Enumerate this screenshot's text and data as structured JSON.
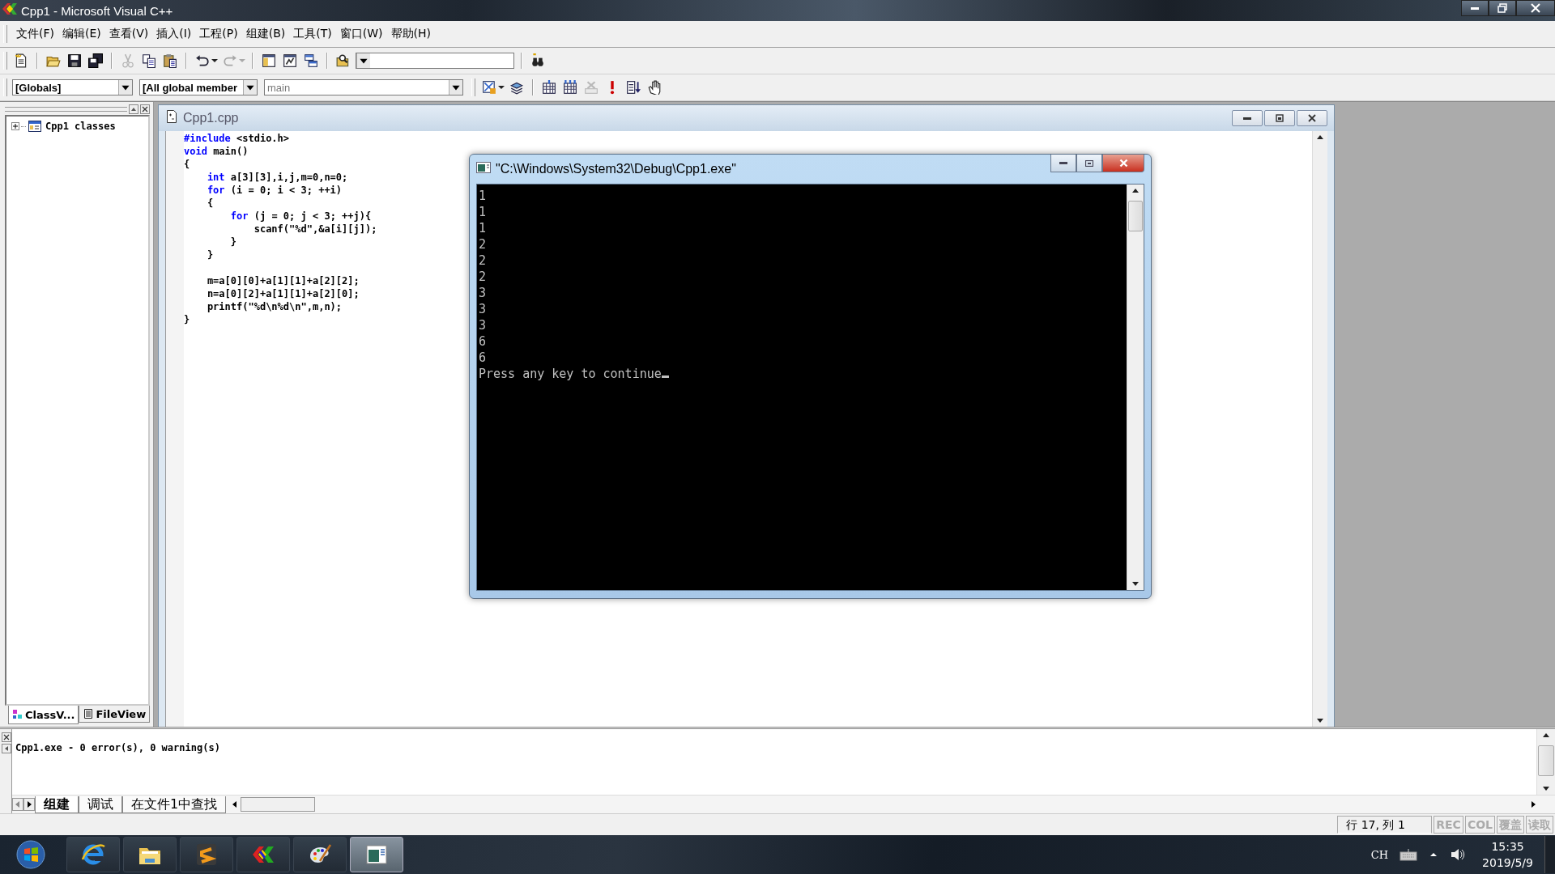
{
  "window": {
    "title": "Cpp1 - Microsoft Visual C++"
  },
  "menu": [
    {
      "label": "文件(F)"
    },
    {
      "label": "编辑(E)"
    },
    {
      "label": "查看(V)"
    },
    {
      "label": "插入(I)"
    },
    {
      "label": "工程(P)"
    },
    {
      "label": "组建(B)"
    },
    {
      "label": "工具(T)"
    },
    {
      "label": "窗口(W)"
    },
    {
      "label": "帮助(H)"
    }
  ],
  "toolbar": [
    {
      "kind": "new",
      "disabled": false
    },
    {
      "kind": "sep"
    },
    {
      "kind": "open",
      "disabled": false
    },
    {
      "kind": "save",
      "disabled": false
    },
    {
      "kind": "saveall",
      "disabled": false
    },
    {
      "kind": "sep"
    },
    {
      "kind": "cut",
      "disabled": true
    },
    {
      "kind": "copy",
      "disabled": false
    },
    {
      "kind": "paste",
      "disabled": false
    },
    {
      "kind": "sep"
    },
    {
      "kind": "undo",
      "disabled": false
    },
    {
      "kind": "redo",
      "disabled": true
    },
    {
      "kind": "sep"
    },
    {
      "kind": "workspace",
      "disabled": false
    },
    {
      "kind": "output",
      "disabled": false
    },
    {
      "kind": "windows",
      "disabled": false
    },
    {
      "kind": "sep"
    },
    {
      "kind": "findfiles",
      "disabled": false
    },
    {
      "kind": "findcombo"
    },
    {
      "kind": "sep"
    },
    {
      "kind": "find",
      "disabled": false
    }
  ],
  "wizard_bar": {
    "combos": [
      "[Globals]",
      "[All global member",
      "main"
    ]
  },
  "build_toolbar": [
    {
      "kind": "wizard",
      "disabled": false
    },
    {
      "kind": "sep"
    },
    {
      "kind": "compile",
      "disabled": false
    },
    {
      "kind": "build",
      "disabled": false
    },
    {
      "kind": "stop",
      "disabled": true
    },
    {
      "kind": "execute",
      "disabled": false
    },
    {
      "kind": "go",
      "disabled": false
    },
    {
      "kind": "breakpoint",
      "disabled": false
    }
  ],
  "workspace": {
    "tree": [
      {
        "label": "Cpp1 classes",
        "expanded": false
      }
    ],
    "tabs": [
      {
        "label": "ClassV...",
        "selected": true
      },
      {
        "label": "FileView",
        "selected": false
      }
    ]
  },
  "editor": {
    "title": "Cpp1.cpp",
    "lines": [
      {
        "segments": [
          {
            "kind": "keyword",
            "text": "#include"
          },
          {
            "kind": "plain",
            "text": " <stdio.h>"
          }
        ]
      },
      {
        "segments": [
          {
            "kind": "keyword",
            "text": "void"
          },
          {
            "kind": "plain",
            "text": " main()"
          }
        ]
      },
      {
        "segments": [
          {
            "kind": "plain",
            "text": "{"
          }
        ]
      },
      {
        "segments": [
          {
            "kind": "keyword",
            "text": "    int"
          },
          {
            "kind": "plain",
            "text": " a[3][3],i,j,m=0,n=0;"
          }
        ]
      },
      {
        "segments": [
          {
            "kind": "keyword",
            "text": "    for"
          },
          {
            "kind": "plain",
            "text": " (i = 0; i < 3; ++i)"
          }
        ]
      },
      {
        "segments": [
          {
            "kind": "plain",
            "text": "    {"
          }
        ]
      },
      {
        "segments": [
          {
            "kind": "keyword",
            "text": "        for"
          },
          {
            "kind": "plain",
            "text": " (j = 0; j < 3; ++j){"
          }
        ]
      },
      {
        "segments": [
          {
            "kind": "plain",
            "text": "            scanf(\"%d\",&a[i][j]);"
          }
        ]
      },
      {
        "segments": [
          {
            "kind": "plain",
            "text": "        }"
          }
        ]
      },
      {
        "segments": [
          {
            "kind": "plain",
            "text": "    }"
          }
        ]
      },
      {
        "kind": "blank"
      },
      {
        "segments": [
          {
            "kind": "plain",
            "text": "    m=a[0][0]+a[1][1]+a[2][2];"
          }
        ]
      },
      {
        "segments": [
          {
            "kind": "plain",
            "text": "    n=a[0][2]+a[1][1]+a[2][0];"
          }
        ]
      },
      {
        "segments": [
          {
            "kind": "plain",
            "text": "    printf(\"%d\\n%d\\n\",m,n);"
          }
        ]
      },
      {
        "segments": [
          {
            "kind": "plain",
            "text": "}"
          }
        ]
      }
    ]
  },
  "console": {
    "title": "\"C:\\Windows\\System32\\Debug\\Cpp1.exe\"",
    "lines": [
      "1",
      "1",
      "1",
      "2",
      "2",
      "2",
      "3",
      "3",
      "3",
      "6",
      "6",
      "Press any key to continue"
    ],
    "cursor": true
  },
  "output": {
    "lines": [
      "Cpp1.exe - 0 error(s), 0 warning(s)"
    ],
    "tabs": [
      {
        "label": "组建",
        "selected": true
      },
      {
        "label": "调试",
        "selected": false
      },
      {
        "label": "在文件1中查找",
        "selected": false
      }
    ]
  },
  "status_bar": {
    "position": "行 17, 列 1",
    "indicators": [
      {
        "label": "REC",
        "active": false
      },
      {
        "label": "COL",
        "active": false
      },
      {
        "label": "覆盖",
        "active": false
      },
      {
        "label": "读取",
        "active": false
      }
    ]
  },
  "taskbar": {
    "apps": [
      {
        "kind": "browser",
        "selected": false
      },
      {
        "kind": "folder",
        "selected": false
      },
      {
        "kind": "editor",
        "selected": false
      },
      {
        "kind": "ide",
        "selected": false
      },
      {
        "kind": "paint",
        "selected": false
      },
      {
        "kind": "console",
        "selected": true
      }
    ],
    "tray": {
      "language": "CH",
      "time": "15:35",
      "date": "2019/5/9"
    }
  }
}
